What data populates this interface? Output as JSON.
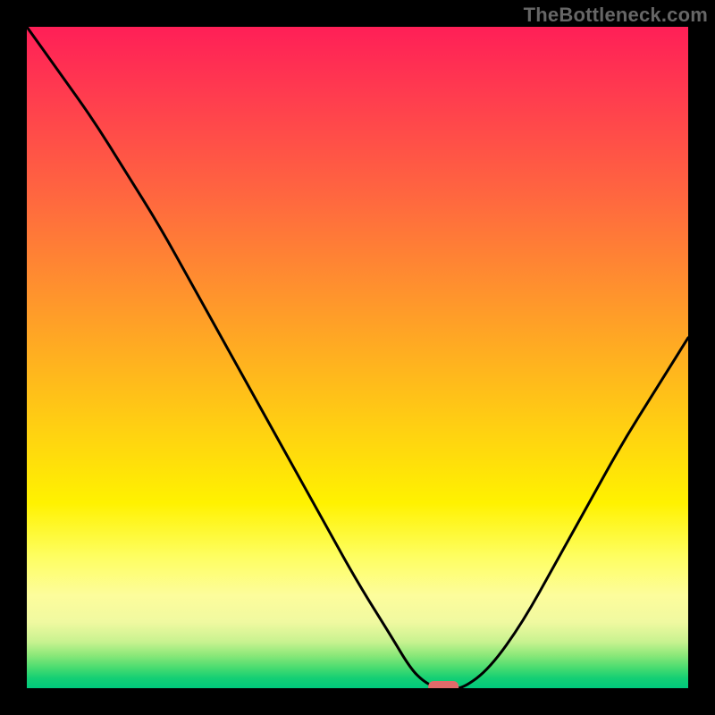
{
  "watermark": "TheBottleneck.com",
  "accent_colors": {
    "top": "#ff1f57",
    "mid": "#ffd410",
    "bottom": "#00c97c",
    "curve": "#000000",
    "marker": "#e06a6a",
    "frame": "#000000"
  },
  "chart_data": {
    "type": "line",
    "title": "",
    "xlabel": "",
    "ylabel": "",
    "xlim": [
      0,
      100
    ],
    "ylim": [
      0,
      100
    ],
    "grid": false,
    "x": [
      0,
      5,
      10,
      15,
      20,
      25,
      30,
      35,
      40,
      45,
      50,
      55,
      58,
      60,
      62,
      64,
      66,
      70,
      75,
      80,
      85,
      90,
      95,
      100
    ],
    "values": [
      100,
      93,
      86,
      78,
      70,
      61,
      52,
      43,
      34,
      25,
      16,
      8,
      3,
      1,
      0,
      0,
      0,
      3,
      10,
      19,
      28,
      37,
      45,
      53
    ],
    "minimum_marker": {
      "x": 63,
      "y": 0
    },
    "annotations": []
  }
}
